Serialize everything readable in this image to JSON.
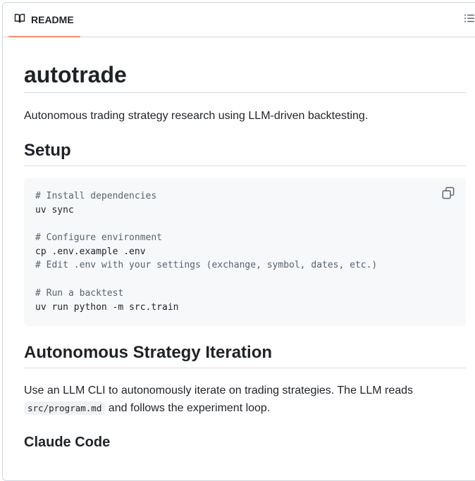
{
  "tab": {
    "label": "README",
    "icon": "book-icon"
  },
  "toc_button": {
    "icon": "list-unordered-icon"
  },
  "readme": {
    "title": "autotrade",
    "description": "Autonomous trading strategy research using LLM-driven backtesting.",
    "setup_heading": "Setup",
    "code_lines": [
      {
        "text": "# Install dependencies",
        "comment": true
      },
      {
        "text": "uv sync",
        "comment": false
      },
      {
        "text": "",
        "comment": false
      },
      {
        "text": "# Configure environment",
        "comment": true
      },
      {
        "text": "cp .env.example .env",
        "comment": false
      },
      {
        "text": "# Edit .env with your settings (exchange, symbol, dates, etc.)",
        "comment": true
      },
      {
        "text": "",
        "comment": false
      },
      {
        "text": "# Run a backtest",
        "comment": true
      },
      {
        "text": "uv run python -m src.train",
        "comment": false
      }
    ],
    "copy_icon": "copy-icon",
    "iteration_heading": "Autonomous Strategy Iteration",
    "iteration_text_1": "Use an LLM CLI to autonomously iterate on trading strategies. The LLM reads",
    "iteration_code": "src/program.md",
    "iteration_text_2": " and follows the experiment loop.",
    "claude_heading": "Claude Code"
  },
  "colors": {
    "tab_underline": "#fd8c73",
    "border": "#d0d7de",
    "code_bg": "#f6f8fa",
    "text": "#1f2328",
    "comment": "#59636e"
  }
}
